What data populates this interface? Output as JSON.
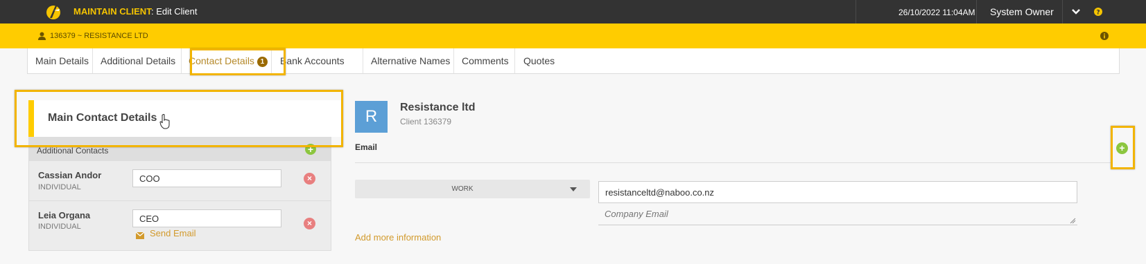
{
  "header": {
    "app_title": "MAINTAIN CLIENT",
    "app_subtitle": ": Edit Client",
    "datetime": "26/10/2022 11:04AM",
    "user": "System Owner"
  },
  "client_bar": {
    "client_ref": "136379 ~ RESISTANCE LTD"
  },
  "tabs": [
    {
      "label": "Main Details"
    },
    {
      "label": "Additional Details"
    },
    {
      "label": "Contact Details",
      "badge": "1",
      "active": true
    },
    {
      "label": "Bank Accounts"
    },
    {
      "label": "Alternative Names"
    },
    {
      "label": "Comments"
    },
    {
      "label": "Quotes"
    }
  ],
  "main_contact": {
    "title": "Main Contact Details"
  },
  "additional_contacts": {
    "label": "Additional Contacts",
    "contacts": [
      {
        "name": "Cassian Andor",
        "type": "INDIVIDUAL",
        "role": "COO"
      },
      {
        "name": "Leia Organa",
        "type": "INDIVIDUAL",
        "role": "CEO",
        "send_email_label": "Send Email"
      }
    ]
  },
  "client": {
    "avatar_letter": "R",
    "name": "Resistance ltd",
    "number": "Client 136379"
  },
  "email_section": {
    "label": "Email",
    "type": "WORK",
    "address": "resistanceltd@naboo.co.nz",
    "description_placeholder": "Company Email",
    "add_more": "Add more information"
  },
  "colors": {
    "topbar": "#333333",
    "accent_yellow": "#ffcc00",
    "highlight": "#f2b400",
    "link": "#d29a2c",
    "avatar": "#5c9fd6",
    "add_green": "#8cc63f",
    "delete_red": "#e87f7f"
  }
}
